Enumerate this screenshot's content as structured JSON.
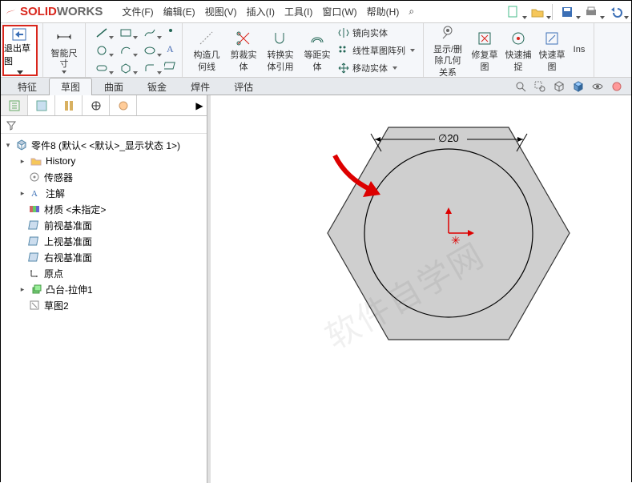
{
  "logo": {
    "solid": "SOLID",
    "works": "WORKS"
  },
  "menu": {
    "file": "文件(F)",
    "edit": "编辑(E)",
    "view": "视图(V)",
    "insert": "插入(I)",
    "tools": "工具(I)",
    "window": "窗口(W)",
    "help": "帮助(H)",
    "search": "⌕"
  },
  "ribbon": {
    "exitSketch": "退出草图",
    "smartDim": "智能尺寸",
    "constructGeom1": "构造几",
    "constructGeom2": "何线",
    "trimEntity1": "剪裁实",
    "trimEntity2": "体",
    "convertEntity1": "转换实",
    "convertEntity2": "体引用",
    "offsetEntity1": "等距实",
    "offsetEntity2": "体",
    "mirror": "镜向实体",
    "linearPattern": "线性草图阵列",
    "moveEntity": "移动实体",
    "showDelRel1": "显示/删",
    "showDelRel2": "除几何",
    "showDelRel3": "关系",
    "repairSketch1": "修复草",
    "repairSketch2": "图",
    "quickSnap1": "快速捕",
    "quickSnap2": "捉",
    "rapidSketch1": "快速草",
    "rapidSketch2": "图",
    "ins": "Ins"
  },
  "tabs": {
    "features": "特征",
    "sketch": "草图",
    "surfaces": "曲面",
    "sheetmetal": "钣金",
    "weldments": "焊件",
    "evaluate": "评估"
  },
  "tree": {
    "root": "零件8  (默认< <默认>_显示状态 1>)",
    "history": "History",
    "sensors": "传感器",
    "annotations": "注解",
    "material": "材质 <未指定>",
    "frontPlane": "前视基准面",
    "topPlane": "上视基准面",
    "rightPlane": "右视基准面",
    "origin": "原点",
    "bossExtrude": "凸台-拉伸1",
    "sketch2": "草图2"
  },
  "canvas": {
    "dimLabel": "∅20"
  },
  "watermark": "软件自学网"
}
